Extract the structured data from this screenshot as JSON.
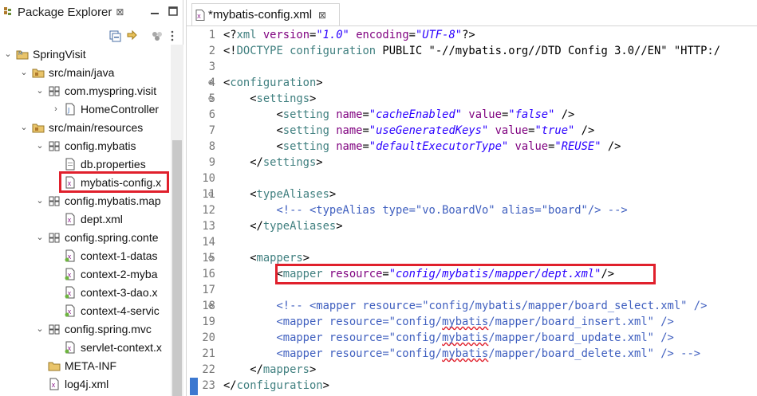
{
  "explorer": {
    "tab_label": "Package Explorer",
    "tab_close": "⊠",
    "tree": [
      {
        "label": "SpringVisit",
        "icon": "project-icon",
        "expanded": true,
        "depth": 0
      },
      {
        "label": "src/main/java",
        "icon": "source-folder-icon",
        "expanded": true,
        "depth": 1
      },
      {
        "label": "com.myspring.visit",
        "icon": "package-icon",
        "expanded": true,
        "depth": 2
      },
      {
        "label": "HomeController",
        "icon": "java-file-icon",
        "expanded": false,
        "depth": 3
      },
      {
        "label": "src/main/resources",
        "icon": "source-folder-icon",
        "expanded": true,
        "depth": 1
      },
      {
        "label": "config.mybatis",
        "icon": "package-icon",
        "expanded": true,
        "depth": 2
      },
      {
        "label": "db.properties",
        "icon": "file-icon",
        "expanded": null,
        "depth": 3
      },
      {
        "label": "mybatis-config.x",
        "icon": "xml-file-icon",
        "expanded": null,
        "depth": 3
      },
      {
        "label": "config.mybatis.map",
        "icon": "package-icon",
        "expanded": true,
        "depth": 2
      },
      {
        "label": "dept.xml",
        "icon": "xml-file-icon",
        "expanded": null,
        "depth": 3
      },
      {
        "label": "config.spring.conte",
        "icon": "package-icon",
        "expanded": true,
        "depth": 2
      },
      {
        "label": "context-1-datas",
        "icon": "spring-xml-icon",
        "expanded": null,
        "depth": 3
      },
      {
        "label": "context-2-myba",
        "icon": "spring-xml-icon",
        "expanded": null,
        "depth": 3
      },
      {
        "label": "context-3-dao.x",
        "icon": "spring-xml-icon",
        "expanded": null,
        "depth": 3
      },
      {
        "label": "context-4-servic",
        "icon": "spring-xml-icon",
        "expanded": null,
        "depth": 3
      },
      {
        "label": "config.spring.mvc",
        "icon": "package-icon",
        "expanded": true,
        "depth": 2
      },
      {
        "label": "servlet-context.x",
        "icon": "spring-xml-icon",
        "expanded": null,
        "depth": 3
      },
      {
        "label": "META-INF",
        "icon": "folder-icon",
        "expanded": null,
        "depth": 2
      },
      {
        "label": "log4j.xml",
        "icon": "xml-file-icon",
        "expanded": null,
        "depth": 2
      }
    ],
    "highlighted_item": "mybatis-config.x"
  },
  "editor": {
    "tab_label": "*mybatis-config.xml",
    "tab_close": "⊠",
    "lines": [
      {
        "n": "1",
        "fold": "",
        "tokens": [
          [
            "p",
            "<?"
          ],
          [
            "t",
            "xml"
          ],
          [
            "p",
            " "
          ],
          [
            "a",
            "version"
          ],
          [
            "p",
            "="
          ],
          [
            "v",
            "\"1.0\""
          ],
          [
            "p",
            " "
          ],
          [
            "a",
            "encoding"
          ],
          [
            "p",
            "="
          ],
          [
            "v",
            "\"UTF-8\""
          ],
          [
            "p",
            "?>"
          ]
        ]
      },
      {
        "n": "2",
        "fold": "",
        "tokens": [
          [
            "p",
            "<!"
          ],
          [
            "t",
            "DOCTYPE"
          ],
          [
            "p",
            " "
          ],
          [
            "t",
            "configuration"
          ],
          [
            "p",
            " PUBLIC \"-//mybatis.org//DTD Config 3.0//EN\" \"HTTP:/"
          ]
        ]
      },
      {
        "n": "3",
        "fold": "",
        "tokens": []
      },
      {
        "n": "4",
        "fold": "⊖",
        "tokens": [
          [
            "p",
            "<"
          ],
          [
            "t",
            "configuration"
          ],
          [
            "p",
            ">"
          ]
        ]
      },
      {
        "n": "5",
        "fold": "⊖",
        "tokens": [
          [
            "p",
            "    <"
          ],
          [
            "t",
            "settings"
          ],
          [
            "p",
            ">"
          ]
        ]
      },
      {
        "n": "6",
        "fold": "",
        "tokens": [
          [
            "p",
            "        <"
          ],
          [
            "t",
            "setting"
          ],
          [
            "p",
            " "
          ],
          [
            "a",
            "name"
          ],
          [
            "p",
            "="
          ],
          [
            "v",
            "\"cacheEnabled\""
          ],
          [
            "p",
            " "
          ],
          [
            "a",
            "value"
          ],
          [
            "p",
            "="
          ],
          [
            "v",
            "\"false\""
          ],
          [
            "p",
            " />"
          ]
        ]
      },
      {
        "n": "7",
        "fold": "",
        "tokens": [
          [
            "p",
            "        <"
          ],
          [
            "t",
            "setting"
          ],
          [
            "p",
            " "
          ],
          [
            "a",
            "name"
          ],
          [
            "p",
            "="
          ],
          [
            "v",
            "\"useGeneratedKeys\""
          ],
          [
            "p",
            " "
          ],
          [
            "a",
            "value"
          ],
          [
            "p",
            "="
          ],
          [
            "v",
            "\"true\""
          ],
          [
            "p",
            " />"
          ]
        ]
      },
      {
        "n": "8",
        "fold": "",
        "tokens": [
          [
            "p",
            "        <"
          ],
          [
            "t",
            "setting"
          ],
          [
            "p",
            " "
          ],
          [
            "a",
            "name"
          ],
          [
            "p",
            "="
          ],
          [
            "v",
            "\"defaultExecutorType\""
          ],
          [
            "p",
            " "
          ],
          [
            "a",
            "value"
          ],
          [
            "p",
            "="
          ],
          [
            "v",
            "\"REUSE\""
          ],
          [
            "p",
            " />"
          ]
        ]
      },
      {
        "n": "9",
        "fold": "",
        "tokens": [
          [
            "p",
            "    </"
          ],
          [
            "t",
            "settings"
          ],
          [
            "p",
            ">"
          ]
        ]
      },
      {
        "n": "10",
        "fold": "",
        "tokens": []
      },
      {
        "n": "11",
        "fold": "⊖",
        "tokens": [
          [
            "p",
            "    <"
          ],
          [
            "t",
            "typeAliases"
          ],
          [
            "p",
            ">"
          ]
        ]
      },
      {
        "n": "12",
        "fold": "",
        "tokens": [
          [
            "c",
            "        <!-- <typeAlias type=\"vo.BoardVo\" alias=\"board\"/> -->"
          ]
        ]
      },
      {
        "n": "13",
        "fold": "",
        "tokens": [
          [
            "p",
            "    </"
          ],
          [
            "t",
            "typeAliases"
          ],
          [
            "p",
            ">"
          ]
        ]
      },
      {
        "n": "14",
        "fold": "",
        "tokens": []
      },
      {
        "n": "15",
        "fold": "⊖",
        "tokens": [
          [
            "p",
            "    <"
          ],
          [
            "t",
            "mappers"
          ],
          [
            "p",
            ">"
          ]
        ]
      },
      {
        "n": "16",
        "fold": "",
        "tokens": [
          [
            "p",
            "        <"
          ],
          [
            "t",
            "mapper"
          ],
          [
            "p",
            " "
          ],
          [
            "a",
            "resource"
          ],
          [
            "p",
            "="
          ],
          [
            "v",
            "\"config/mybatis/mapper/dept.xml\""
          ],
          [
            "p",
            "/>"
          ]
        ]
      },
      {
        "n": "17",
        "fold": "",
        "tokens": []
      },
      {
        "n": "18",
        "fold": "⊖",
        "tokens": [
          [
            "c",
            "        <!-- <mapper resource=\"config/mybatis/mapper/board_select.xml\" />"
          ]
        ]
      },
      {
        "n": "19",
        "fold": "",
        "tokens": [
          [
            "c",
            "        <mapper resource=\"config/"
          ],
          [
            "cs",
            "mybatis"
          ],
          [
            "c",
            "/mapper/board_insert.xml\" />"
          ]
        ]
      },
      {
        "n": "20",
        "fold": "",
        "tokens": [
          [
            "c",
            "        <mapper resource=\"config/"
          ],
          [
            "cs",
            "mybatis"
          ],
          [
            "c",
            "/mapper/board_update.xml\" />"
          ]
        ]
      },
      {
        "n": "21",
        "fold": "",
        "tokens": [
          [
            "c",
            "        <mapper resource=\"config/"
          ],
          [
            "cs",
            "mybatis"
          ],
          [
            "c",
            "/mapper/board_delete.xml\" /> -->"
          ]
        ]
      },
      {
        "n": "22",
        "fold": "",
        "tokens": [
          [
            "p",
            "    </"
          ],
          [
            "t",
            "mappers"
          ],
          [
            "p",
            ">"
          ]
        ]
      },
      {
        "n": "23",
        "fold": "",
        "tokens": [
          [
            "p",
            "</"
          ],
          [
            "t",
            "configuration"
          ],
          [
            "p",
            ">"
          ]
        ]
      }
    ],
    "highlighted_line": "16"
  },
  "colors": {
    "highlight_box": "#e0202c",
    "tag": "#3f7f7f",
    "attribute": "#7f007f",
    "value": "#2a00ff",
    "comment": "#3f5fbf"
  }
}
